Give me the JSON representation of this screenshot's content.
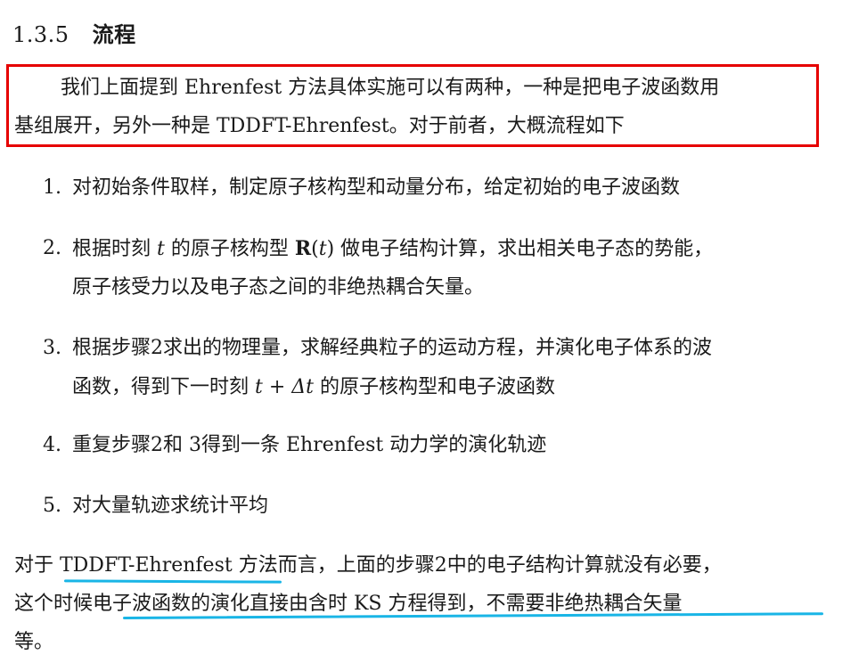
{
  "section": {
    "number": "1.3.5",
    "title": "流程"
  },
  "intro": {
    "line1": "我们上面提到 Ehrenfest 方法具体实施可以有两种，一种是把电子波函数用",
    "line2": "基组展开，另外一种是 TDDFT-Ehrenfest。对于前者，大概流程如下"
  },
  "steps": [
    {
      "marker": "1.",
      "line1": "对初始条件取样，制定原子核构型和动量分布，给定初始的电子波函数"
    },
    {
      "marker": "2.",
      "line1_a": "根据时刻 ",
      "line1_var": "t",
      "line1_b": " 的原子核构型 ",
      "line1_bold": "R",
      "line1_c": "(",
      "line1_var2": "t",
      "line1_d": ") 做电子结构计算，求出相关电子态的势能，",
      "line2": "原子核受力以及电子态之间的非绝热耦合矢量。"
    },
    {
      "marker": "3.",
      "line1": "根据步骤2求出的物理量，求解经典粒子的运动方程，并演化电子体系的波",
      "line2_a": "函数，得到下一时刻 ",
      "line2_math": "t + Δt",
      "line2_b": " 的原子核构型和电子波函数"
    },
    {
      "marker": "4.",
      "line1": "重复步骤2和 3得到一条 Ehrenfest 动力学的演化轨迹"
    },
    {
      "marker": "5.",
      "line1": "对大量轨迹求统计平均"
    }
  ],
  "closing": {
    "line1": "对于 TDDFT-Ehrenfest 方法而言，上面的步骤2中的电子结构计算就没有必要，",
    "line2": "这个时候电子波函数的演化直接由含时 KS 方程得到，不需要非绝热耦合矢量",
    "line3": "等。"
  },
  "colors": {
    "highlight_box": "#e60000",
    "underline": "#19b5e6"
  }
}
